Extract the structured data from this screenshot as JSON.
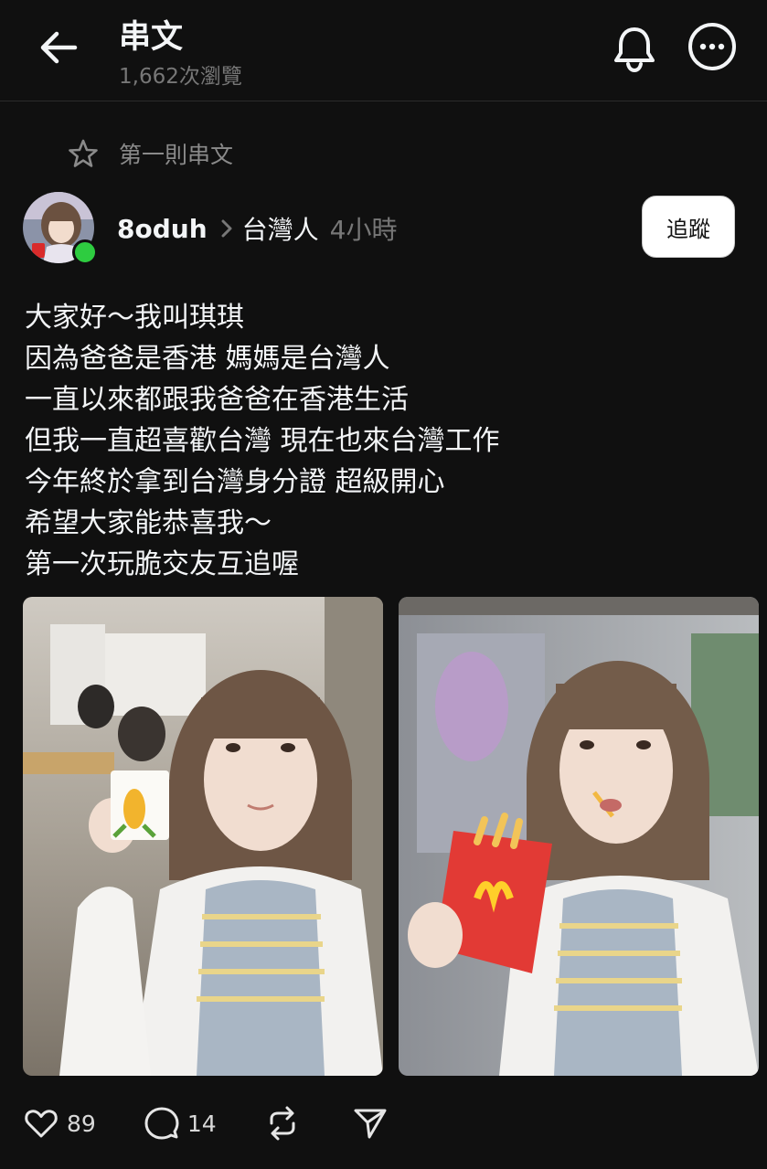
{
  "header": {
    "title": "串文",
    "views": "1,662次瀏覽",
    "back_icon": "arrow-left-icon",
    "bell_icon": "bell-icon",
    "more_icon": "more-circle-icon"
  },
  "pinned": {
    "icon": "star-icon",
    "label": "第一則串文"
  },
  "post": {
    "author": "8oduh",
    "community": "台灣人",
    "time": "4小時",
    "follow_label": "追蹤",
    "online": true,
    "lines": [
      "大家好～我叫琪琪",
      "因為爸爸是香港 媽媽是台灣人",
      "一直以來都跟我爸爸在香港生活",
      "但我一直超喜歡台灣 現在也來台灣工作",
      "今年終於拿到台灣身分證 超級開心",
      "希望大家能恭喜我～",
      "第一次玩脆交友互追喔"
    ],
    "images": [
      "selfie-with-corn-cup",
      "selfie-with-fries"
    ]
  },
  "actions": {
    "likes": "89",
    "comments": "14",
    "like_icon": "heart-icon",
    "comment_icon": "comment-icon",
    "repost_icon": "repost-icon",
    "share_icon": "send-icon"
  },
  "colors": {
    "background": "#101010",
    "text": "#f3f5f7",
    "muted": "#777777",
    "online": "#2ecc40"
  }
}
